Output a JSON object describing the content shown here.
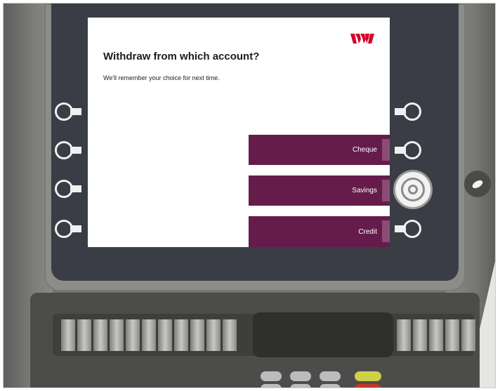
{
  "screen": {
    "title": "Withdraw from which account?",
    "subtitle": "We'll remember your choice for next time.",
    "brand_color": "#d5002b",
    "button_color": "#651c4a",
    "accounts": [
      {
        "label": "Cheque"
      },
      {
        "label": "Savings"
      },
      {
        "label": "Credit"
      }
    ],
    "selected_account": "Savings"
  },
  "keypad": {
    "colors": {
      "grey": "#bcbcbf",
      "yellow": "#cfd04a",
      "red": "#c0392b"
    }
  }
}
